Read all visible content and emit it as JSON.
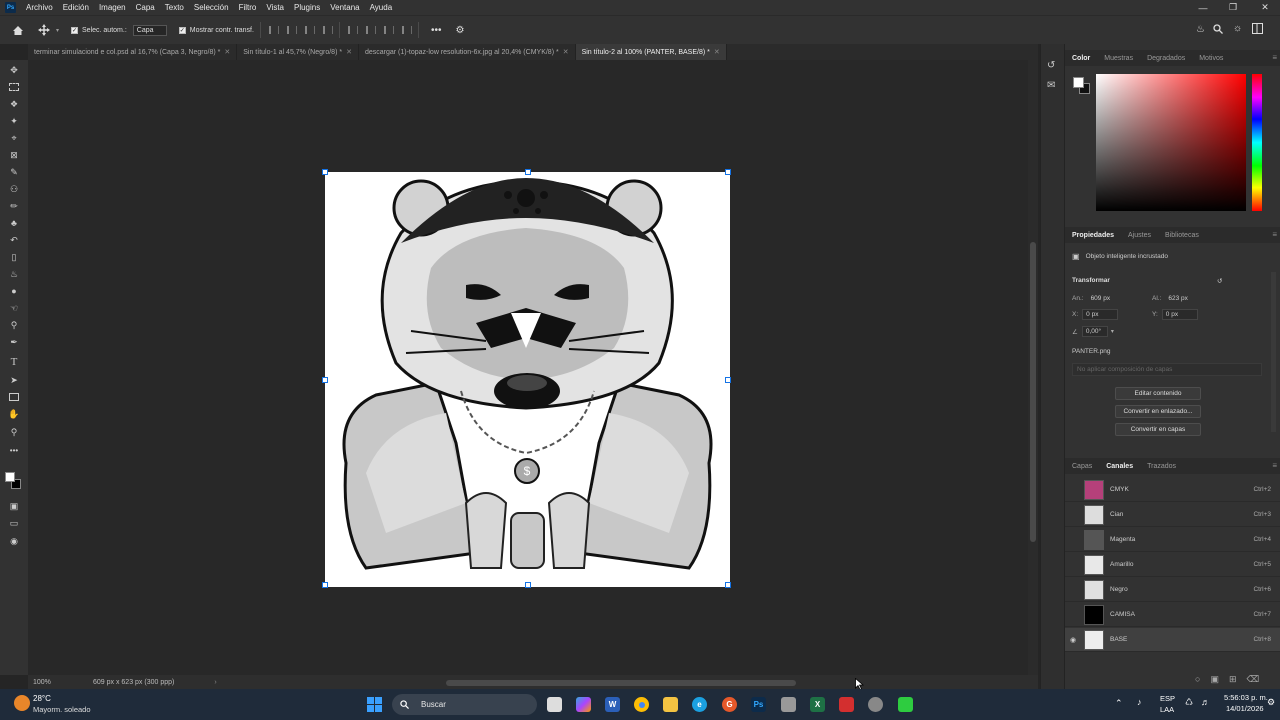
{
  "menubar": {
    "items": [
      "Archivo",
      "Edición",
      "Imagen",
      "Capa",
      "Texto",
      "Selección",
      "Filtro",
      "Vista",
      "Plugins",
      "Ventana",
      "Ayuda"
    ],
    "app_badge": "Ps"
  },
  "options": {
    "auto_select": "Selec. autom.:",
    "auto_select_target": "Capa",
    "show_transform": "Mostrar contr. transf."
  },
  "tabs": [
    {
      "label": "terminar simulaciond e col.psd al 16,7% (Capa 3, Negro/8) *"
    },
    {
      "label": "Sin título-1 al 45,7% (Negro/8) *"
    },
    {
      "label": "descargar (1)-topaz-low resolution-6x.jpg al 20,4% (CMYK/8) *"
    },
    {
      "label": "Sin título-2 al 100% (PANTER, BASE/8) *"
    }
  ],
  "status": {
    "zoom": "100%",
    "doc_info": "609 px x 623 px (300 ppp)"
  },
  "color_panel": {
    "tabs": [
      "Color",
      "Muestras",
      "Degradados",
      "Motivos"
    ]
  },
  "properties": {
    "tabs": [
      "Propiedades",
      "Ajustes",
      "Bibliotecas"
    ],
    "type_label": "Objeto inteligente incrustado",
    "section": "Transformar",
    "an_label": "An.:",
    "an_value": "609 px",
    "al_label": "Al.:",
    "al_value": "623 px",
    "x_label": "X:",
    "x_value": "0 px",
    "y_label": "Y:",
    "y_value": "0 px",
    "angle_value": "0,00°",
    "filename": "PANTER.png",
    "comp_placeholder": "No aplicar composición de capas",
    "buttons": [
      "Editar contenido",
      "Convertir en enlazado...",
      "Convertir en capas"
    ]
  },
  "layers_panel": {
    "tabs": [
      "Capas",
      "Canales",
      "Trazados"
    ],
    "channels": [
      {
        "name": "CMYK",
        "shortcut": "Ctrl+2"
      },
      {
        "name": "Cian",
        "shortcut": "Ctrl+3"
      },
      {
        "name": "Magenta",
        "shortcut": "Ctrl+4"
      },
      {
        "name": "Amarillo",
        "shortcut": "Ctrl+5"
      },
      {
        "name": "Negro",
        "shortcut": "Ctrl+6"
      },
      {
        "name": "CAMISA",
        "shortcut": "Ctrl+7"
      },
      {
        "name": "BASE",
        "shortcut": "Ctrl+8"
      }
    ]
  },
  "taskbar": {
    "weather_temp": "28°C",
    "weather_desc": "Mayorm. soleado",
    "search_label": "Buscar",
    "lang_1": "ESP",
    "lang_2": "LAA",
    "time": "5:56:03 p. m.",
    "date": "14/01/2026"
  }
}
